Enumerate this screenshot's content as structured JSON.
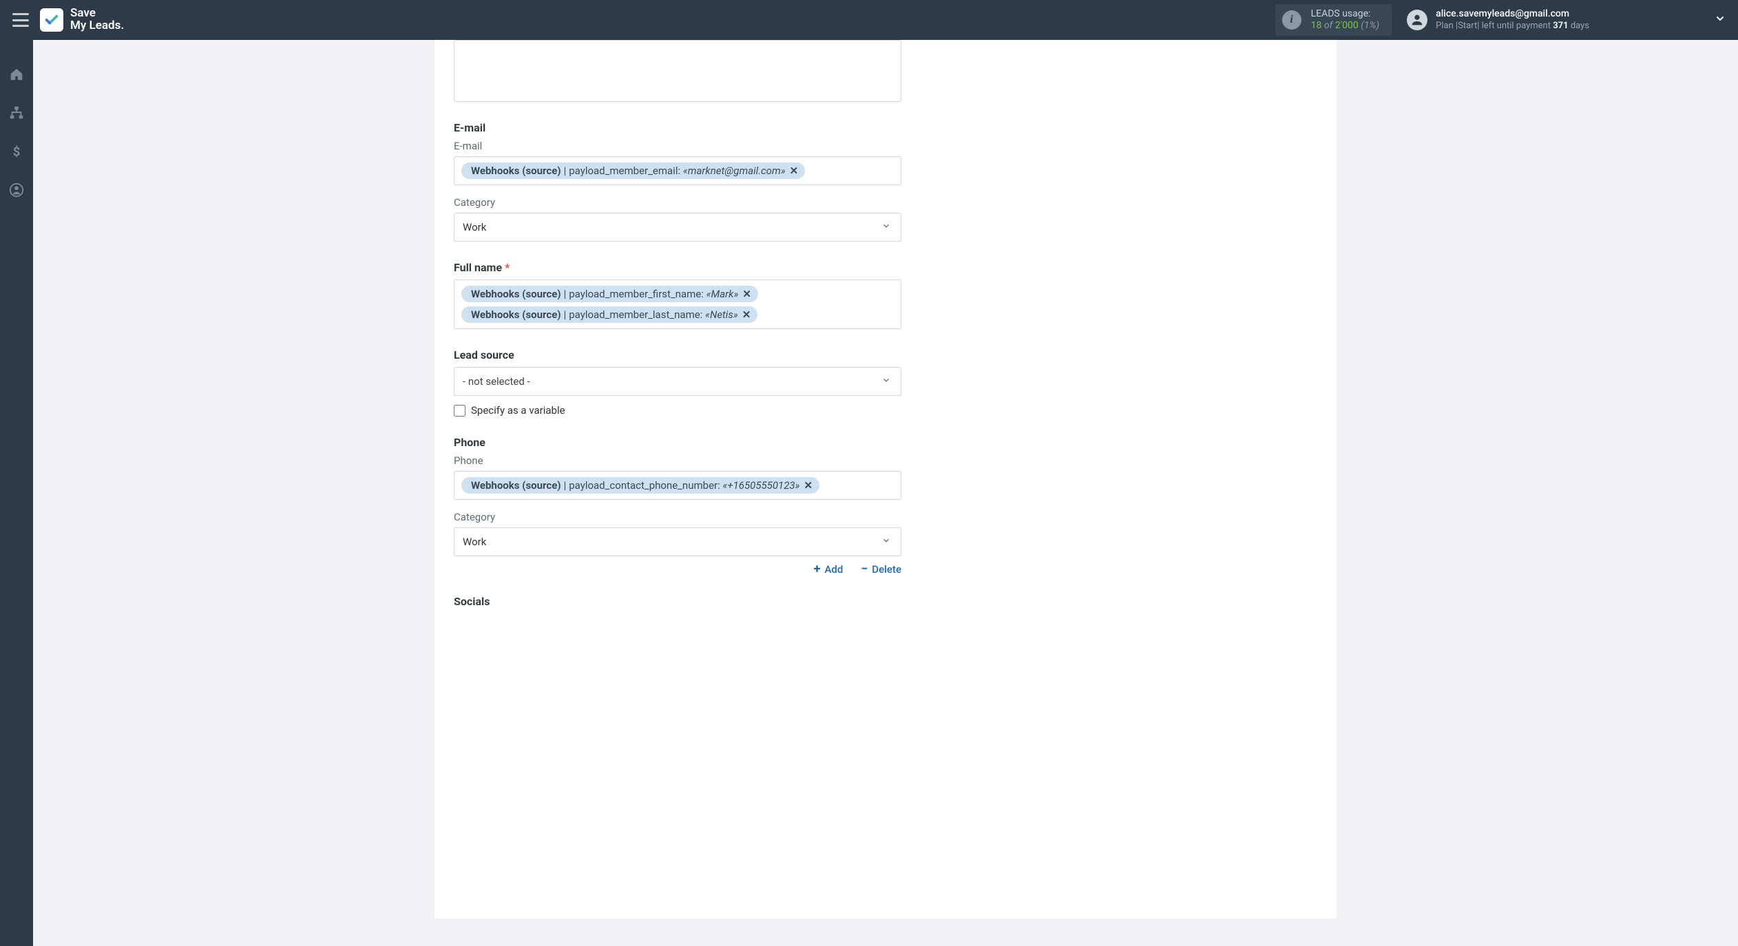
{
  "header": {
    "brand_line1": "Save",
    "brand_line2": "My Leads."
  },
  "usage": {
    "title": "LEADS usage:",
    "current": "18",
    "of": "of",
    "total": "2'000",
    "percent": "(1%)"
  },
  "account": {
    "email": "alice.savemyleads@gmail.com",
    "plan_prefix": "Plan |",
    "plan_name": "Start",
    "plan_mid": "| left until payment ",
    "days": "371",
    "days_suffix": " days"
  },
  "form": {
    "email": {
      "section_label": "E-mail",
      "field_label": "E-mail",
      "tags": [
        {
          "source": "Webhooks (source)",
          "key": "payload_member_email:",
          "value": "«marknet@gmail.com»"
        }
      ],
      "category_label": "Category",
      "category_value": "Work"
    },
    "full_name": {
      "section_label": "Full name",
      "required": true,
      "tags": [
        {
          "source": "Webhooks (source)",
          "key": "payload_member_first_name:",
          "value": "«Mark»"
        },
        {
          "source": "Webhooks (source)",
          "key": "payload_member_last_name:",
          "value": "«Netis»"
        }
      ]
    },
    "lead_source": {
      "section_label": "Lead source",
      "value": "- not selected -",
      "specify_label": "Specify as a variable"
    },
    "phone": {
      "section_label": "Phone",
      "field_label": "Phone",
      "tags": [
        {
          "source": "Webhooks (source)",
          "key": "payload_contact_phone_number:",
          "value": "«+16505550123»"
        }
      ],
      "category_label": "Category",
      "category_value": "Work"
    },
    "actions": {
      "add": "Add",
      "delete": "Delete"
    },
    "socials": {
      "section_label": "Socials"
    }
  }
}
